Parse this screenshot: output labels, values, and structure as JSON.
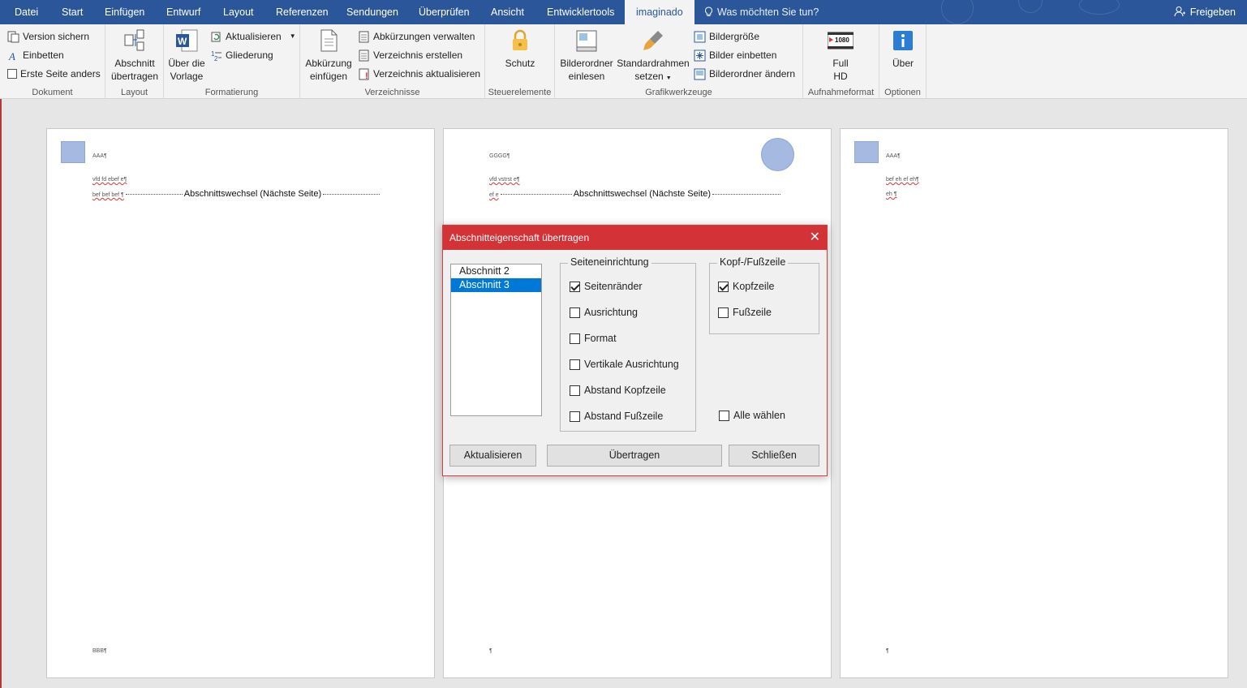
{
  "menu": {
    "tabs": [
      "Datei",
      "Start",
      "Einfügen",
      "Entwurf",
      "Layout",
      "Referenzen",
      "Sendungen",
      "Überprüfen",
      "Ansicht",
      "Entwicklertools",
      "imaginado"
    ],
    "active_tab": "imaginado",
    "help": "Was möchten Sie tun?",
    "share": "Freigeben"
  },
  "ribbon": {
    "dokument": {
      "label": "Dokument",
      "version": "Version sichern",
      "embed": "Einbetten",
      "first_page": "Erste Seite anders"
    },
    "layout": {
      "label": "Layout",
      "section_line1": "Abschnitt",
      "section_line2": "übertragen"
    },
    "formatierung": {
      "label": "Formatierung",
      "template_line1": "Über die",
      "template_line2": "Vorlage",
      "update": "Aktualisieren",
      "outline": "Gliederung"
    },
    "verzeichnisse": {
      "label": "Verzeichnisse",
      "abbr_line1": "Abkürzung",
      "abbr_line2": "einfügen",
      "manage": "Abkürzungen verwalten",
      "create": "Verzeichnis erstellen",
      "update": "Verzeichnis aktualisieren"
    },
    "steuerelemente": {
      "label": "Steuerelemente",
      "protect": "Schutz"
    },
    "grafik": {
      "label": "Grafikwerkzeuge",
      "folder_line1": "Bilderordner",
      "folder_line2": "einlesen",
      "frame_line1": "Standardrahmen",
      "frame_line2": "setzen",
      "size": "Bildergröße",
      "embed": "Bilder einbetten",
      "change": "Bilderordner ändern"
    },
    "aufnahme": {
      "label": "Aufnahmeformat",
      "full_line1": "Full",
      "full_line2": "HD",
      "res": "1080"
    },
    "optionen": {
      "label": "Optionen",
      "about": "Über"
    }
  },
  "pages": [
    {
      "header": "AAA¶",
      "line1": "vfd fd ebef e¶",
      "line2": "bef bef bef ¶",
      "break": "Abschnittswechsel (Nächste Seite)",
      "footer": "BBB¶"
    },
    {
      "header": "GGGG¶",
      "line1": "vfd vstrst e¶",
      "line2": "ef e",
      "break": "Abschnittswechsel (Nächste Seite)",
      "footer": "¶"
    },
    {
      "header": "AAA¶",
      "line1": "bef eh ef eh¶",
      "line2": "eh ¶",
      "footer": "¶"
    }
  ],
  "dialog": {
    "title": "Abschnitteigenschaft übertragen",
    "sections": [
      "Abschnitt 2",
      "Abschnitt 3"
    ],
    "selected_section": "Abschnitt 3",
    "page_setup": {
      "legend": "Seiteneinrichtung",
      "options": [
        {
          "label": "Seitenränder",
          "checked": true
        },
        {
          "label": "Ausrichtung",
          "checked": false
        },
        {
          "label": "Format",
          "checked": false
        },
        {
          "label": "Vertikale Ausrichtung",
          "checked": false
        },
        {
          "label": "Abstand Kopfzeile",
          "checked": false
        },
        {
          "label": "Abstand Fußzeile",
          "checked": false
        }
      ]
    },
    "header_footer": {
      "legend": "Kopf-/Fußzeile",
      "options": [
        {
          "label": "Kopfzeile",
          "checked": true
        },
        {
          "label": "Fußzeile",
          "checked": false
        }
      ]
    },
    "select_all": {
      "label": "Alle wählen",
      "checked": false
    },
    "buttons": {
      "refresh": "Aktualisieren",
      "transfer": "Übertragen",
      "close": "Schließen"
    }
  }
}
